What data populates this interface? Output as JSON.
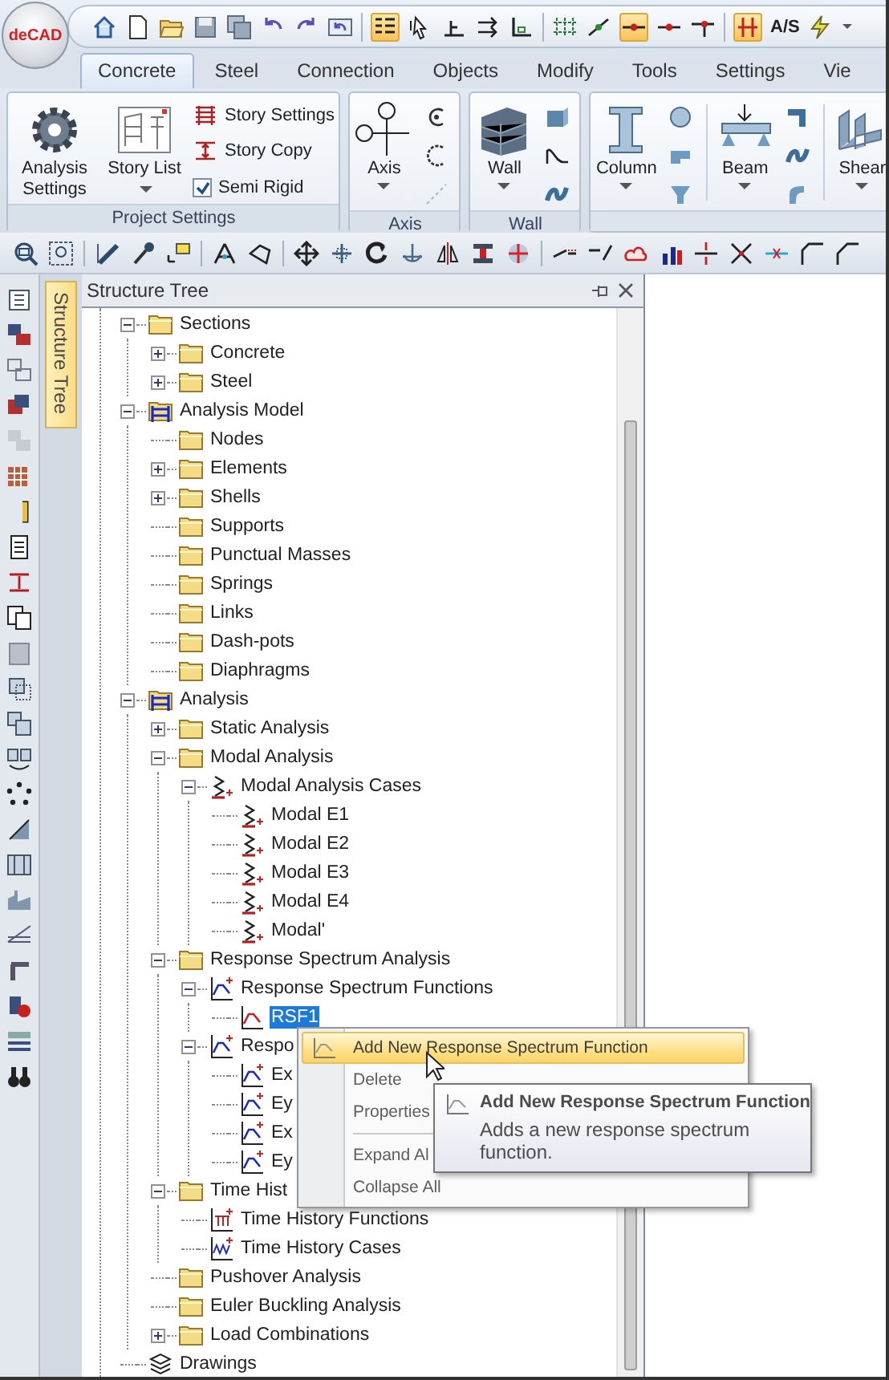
{
  "logo": "deCAD",
  "quick_access_label": "A/S",
  "ribbon_tabs": [
    {
      "label": "Concrete",
      "selected": true
    },
    {
      "label": "Steel",
      "selected": false
    },
    {
      "label": "Connection",
      "selected": false
    },
    {
      "label": "Objects",
      "selected": false
    },
    {
      "label": "Modify",
      "selected": false
    },
    {
      "label": "Tools",
      "selected": false
    },
    {
      "label": "Settings",
      "selected": false
    },
    {
      "label": "Vie",
      "selected": false
    }
  ],
  "ribbon_groups": [
    {
      "title": "Project Settings",
      "buttons": [
        {
          "label": "Analysis Settings",
          "dropdown": false
        },
        {
          "label": "Story List",
          "dropdown": true
        }
      ],
      "small": [
        {
          "kind": "button",
          "label": "Story Settings"
        },
        {
          "kind": "button",
          "label": "Story Copy"
        },
        {
          "kind": "checkbox",
          "label": "Semi Rigid",
          "checked": true
        }
      ]
    },
    {
      "title": "Axis",
      "buttons": [
        {
          "label": "Axis",
          "dropdown": true
        }
      ]
    },
    {
      "title": "Wall",
      "buttons": [
        {
          "label": "Wall",
          "dropdown": true
        }
      ]
    },
    {
      "buttons": [
        {
          "label": "Column",
          "dropdown": true
        },
        {
          "label": "Beam",
          "dropdown": true
        },
        {
          "label": "Shear",
          "dropdown": true
        }
      ]
    }
  ],
  "side_tab": {
    "label": "Structure Tree",
    "selected": true
  },
  "panel": {
    "title": "Structure Tree"
  },
  "tree": [
    {
      "label": "Sections",
      "kind": "folder",
      "expanded": true,
      "selected": false,
      "children": [
        {
          "label": "Concrete",
          "kind": "folder",
          "expanded": false,
          "selected": false
        },
        {
          "label": "Steel",
          "kind": "folder",
          "expanded": false,
          "selected": false
        }
      ]
    },
    {
      "label": "Analysis Model",
      "kind": "frame",
      "expanded": true,
      "selected": false,
      "children": [
        {
          "label": "Nodes",
          "kind": "folder",
          "selected": false
        },
        {
          "label": "Elements",
          "kind": "folder",
          "expanded": false,
          "selected": false
        },
        {
          "label": "Shells",
          "kind": "folder",
          "expanded": false,
          "selected": false
        },
        {
          "label": "Supports",
          "kind": "folder",
          "selected": false
        },
        {
          "label": "Punctual Masses",
          "kind": "folder",
          "selected": false
        },
        {
          "label": "Springs",
          "kind": "folder",
          "selected": false
        },
        {
          "label": "Links",
          "kind": "folder",
          "selected": false
        },
        {
          "label": "Dash-pots",
          "kind": "folder",
          "selected": false
        },
        {
          "label": "Diaphragms",
          "kind": "folder",
          "selected": false
        }
      ]
    },
    {
      "label": "Analysis",
      "kind": "frame",
      "expanded": true,
      "selected": false,
      "children": [
        {
          "label": "Static Analysis",
          "kind": "folder",
          "expanded": false,
          "selected": false
        },
        {
          "label": "Modal Analysis",
          "kind": "folder",
          "expanded": true,
          "selected": false,
          "children": [
            {
              "label": "Modal Analysis Cases",
              "kind": "mode",
              "expanded": true,
              "selected": false,
              "children": [
                {
                  "label": "Modal E1",
                  "kind": "mode",
                  "selected": false
                },
                {
                  "label": "Modal E2",
                  "kind": "mode",
                  "selected": false
                },
                {
                  "label": "Modal E3",
                  "kind": "mode",
                  "selected": false
                },
                {
                  "label": "Modal E4",
                  "kind": "mode",
                  "selected": false
                },
                {
                  "label": "Modal'",
                  "kind": "mode",
                  "selected": false
                }
              ]
            }
          ]
        },
        {
          "label": "Response Spectrum Analysis",
          "kind": "folder",
          "expanded": true,
          "selected": false,
          "children": [
            {
              "label": "Response Spectrum Functions",
              "kind": "spectrum",
              "expanded": true,
              "selected": false,
              "children": [
                {
                  "label": "RSF1",
                  "kind": "curve",
                  "selected": true
                }
              ]
            },
            {
              "label": "Respo",
              "kind": "spectrum",
              "expanded": true,
              "selected": false,
              "children": [
                {
                  "label": "Ex",
                  "kind": "spectrum",
                  "selected": false
                },
                {
                  "label": "Ey",
                  "kind": "spectrum",
                  "selected": false
                },
                {
                  "label": "Ex",
                  "kind": "spectrum",
                  "selected": false
                },
                {
                  "label": "Ey",
                  "kind": "spectrum",
                  "selected": false
                }
              ]
            }
          ]
        },
        {
          "label": "Time Hist",
          "kind": "folder",
          "expanded": true,
          "selected": false,
          "children": [
            {
              "label": "Time History Functions",
              "kind": "function",
              "selected": false
            },
            {
              "label": "Time History Cases",
              "kind": "history",
              "selected": false
            }
          ]
        },
        {
          "label": "Pushover Analysis",
          "kind": "folder",
          "selected": false
        },
        {
          "label": "Euler Buckling Analysis",
          "kind": "folder",
          "selected": false
        },
        {
          "label": "Load Combinations",
          "kind": "folder",
          "expanded": false,
          "selected": false
        }
      ]
    },
    {
      "label": "Drawings",
      "kind": "drawings",
      "selected": false
    }
  ],
  "context_menu": [
    {
      "kind": "item",
      "label": "Add New Response Spectrum Function",
      "selected": true
    },
    {
      "kind": "item",
      "label": "Delete",
      "selected": false
    },
    {
      "kind": "item",
      "label": "Properties",
      "selected": false
    },
    {
      "kind": "separator"
    },
    {
      "kind": "item",
      "label": "Expand Al",
      "selected": false
    },
    {
      "kind": "item",
      "label": "Collapse All",
      "selected": false
    }
  ],
  "tooltip": {
    "title": "Add New Response Spectrum Function",
    "text": "Adds a new response spectrum function."
  }
}
